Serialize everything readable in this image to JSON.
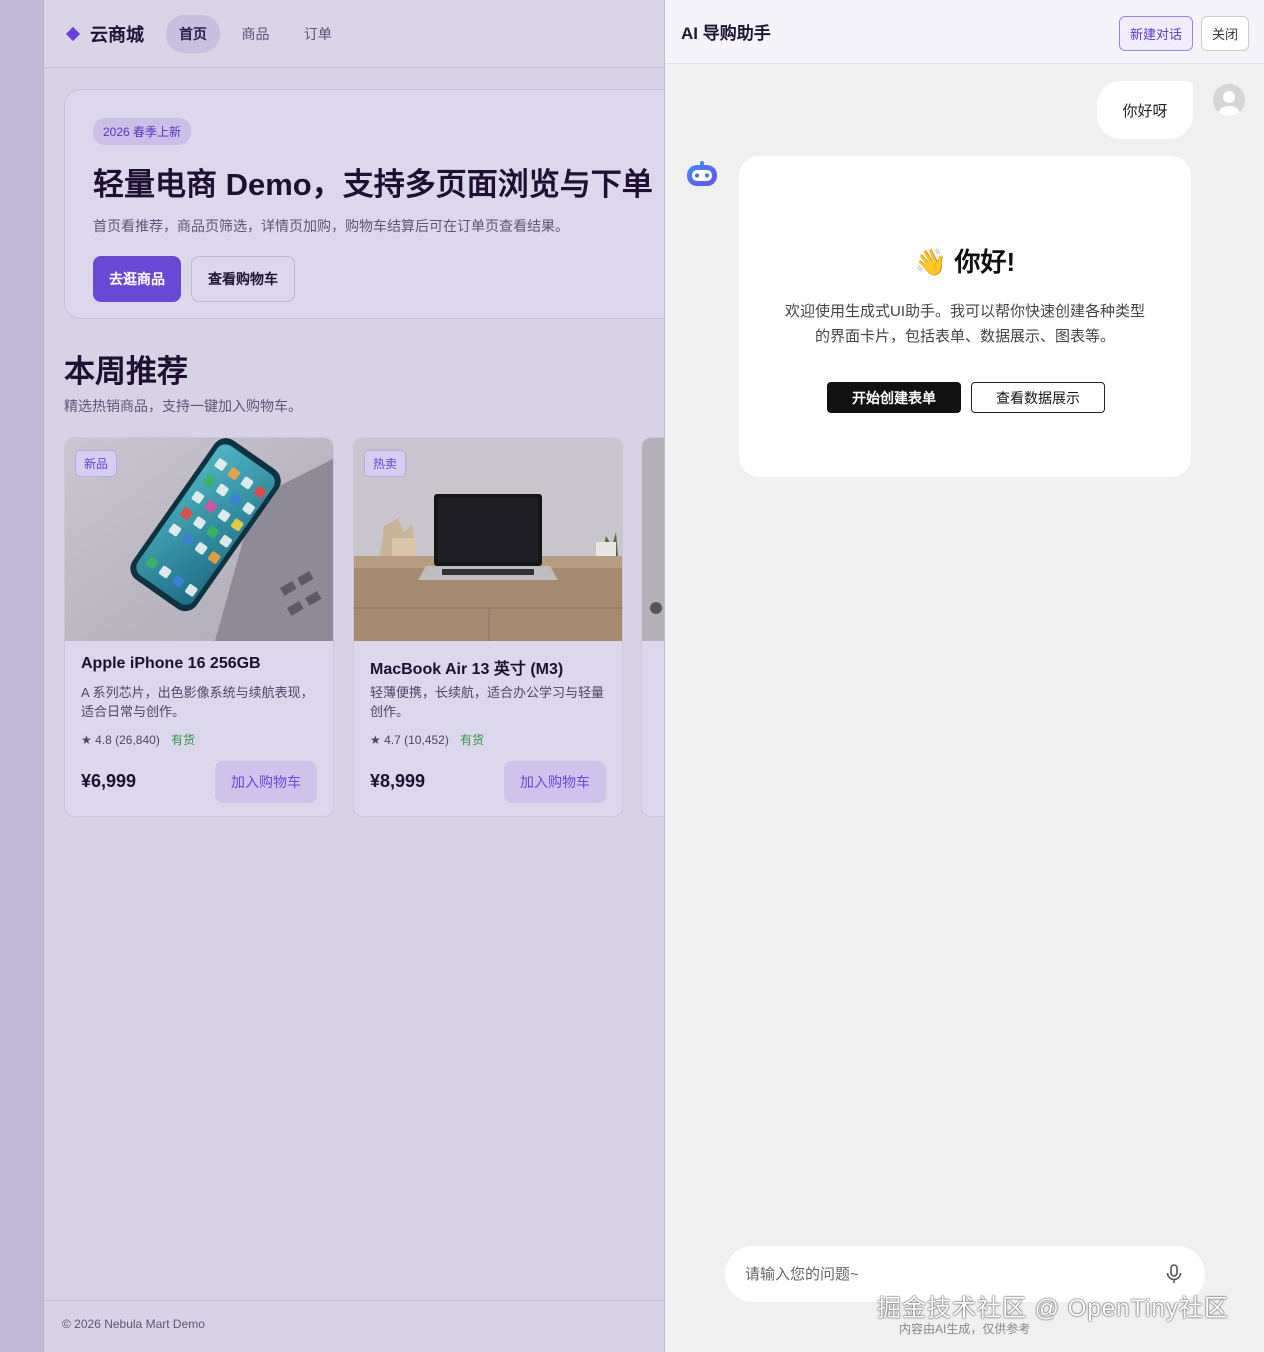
{
  "site": {
    "brand": "云商城",
    "nav": [
      {
        "label": "首页",
        "active": true
      },
      {
        "label": "商品",
        "active": false
      },
      {
        "label": "订单",
        "active": false
      }
    ],
    "hero": {
      "badge": "2026 春季上新",
      "title": "轻量电商 Demo，支持多页面浏览与下单",
      "subtitle": "首页看推荐，商品页筛选，详情页加购，购物车结算后可在订单页查看结果。",
      "primary_cta": "去逛商品",
      "secondary_cta": "查看购物车"
    },
    "section": {
      "title": "本周推荐",
      "subtitle": "精选热销商品，支持一键加入购物车。"
    },
    "products": [
      {
        "tag": "新品",
        "name": "Apple iPhone 16 256GB",
        "desc": "A 系列芯片，出色影像系统与续航表现，适合日常与创作。",
        "rating": "★ 4.8",
        "reviews": "(26,840)",
        "stock": "有货",
        "price": "¥6,999",
        "add": "加入购物车"
      },
      {
        "tag": "热卖",
        "name": "MacBook Air 13 英寸 (M3)",
        "desc": "轻薄便携，长续航，适合办公学习与轻量创作。",
        "rating": "★ 4.7",
        "reviews": "(10,452)",
        "stock": "有货",
        "price": "¥8,999",
        "add": "加入购物车"
      }
    ],
    "footer": "© 2026 Nebula Mart Demo"
  },
  "assistant": {
    "title": "AI 导购助手",
    "new_chat": "新建对话",
    "close": "关闭",
    "user_message": "你好呀",
    "greeting": "👋 你好!",
    "welcome": "欢迎使用生成式UI助手。我可以帮你快速创建各种类型的界面卡片，包括表单、数据展示、图表等。",
    "btn_form": "开始创建表单",
    "btn_data": "查看数据展示",
    "input_placeholder": "请输入您的问题~",
    "watermark": "掘金技术社区 @ OpenTiny社区",
    "disclaimer": "内容由AI生成，仅供参考"
  },
  "colors": {
    "accent": "#6a48d6",
    "stock_green": "#2e9a4c"
  }
}
